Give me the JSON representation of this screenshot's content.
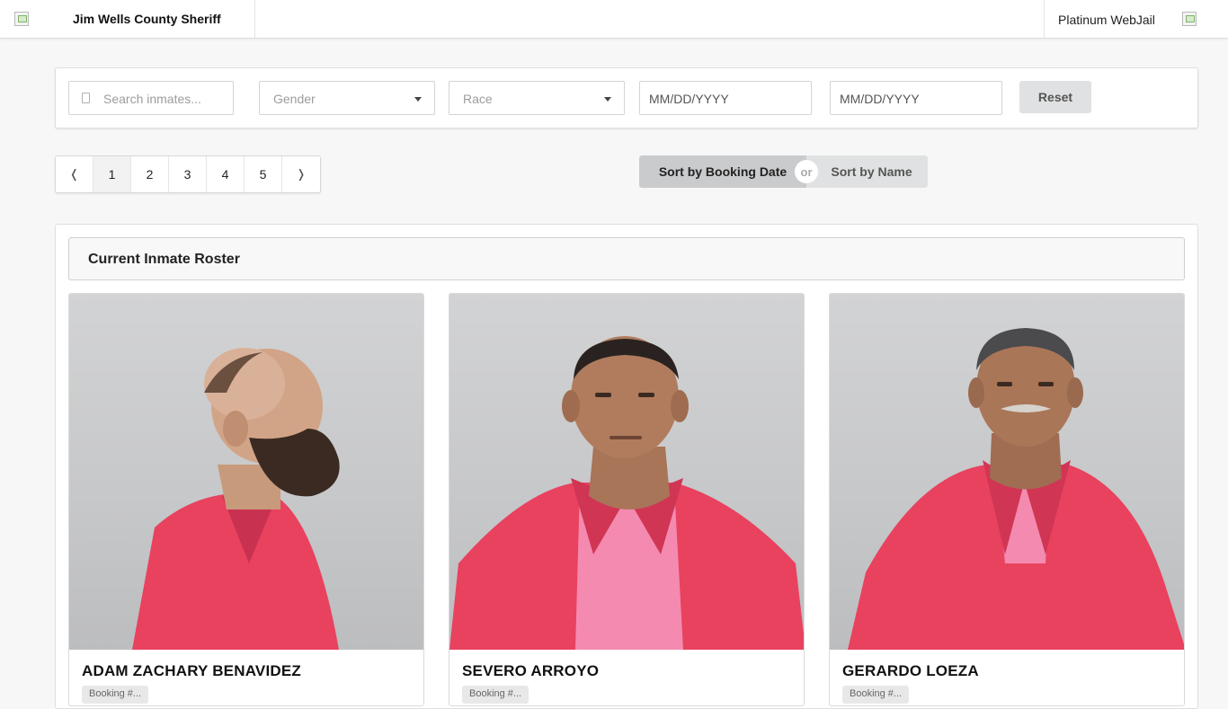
{
  "header": {
    "agency_name": "Jim Wells County Sheriff",
    "product_name": "Platinum WebJail",
    "logo_icon": "broken-image-icon",
    "user_icon": "broken-image-icon"
  },
  "filters": {
    "search_placeholder": "Search inmates...",
    "search_icon": "search-icon",
    "gender_placeholder": "Gender",
    "race_placeholder": "Race",
    "date_from_placeholder": "MM/DD/YYYY",
    "date_to_placeholder": "MM/DD/YYYY",
    "reset_label": "Reset"
  },
  "pagination": {
    "prev_label": "❬",
    "next_label": "❭",
    "pages": [
      "1",
      "2",
      "3",
      "4",
      "5"
    ],
    "active_page": "1"
  },
  "sort": {
    "by_booking_label": "Sort by Booking Date",
    "or_label": "or",
    "by_name_label": "Sort by Name",
    "active": "booking_date"
  },
  "roster": {
    "title": "Current Inmate Roster",
    "inmates": [
      {
        "name": "ADAM ZACHARY BENAVIDEZ",
        "booking_label": "Booking #..."
      },
      {
        "name": "SEVERO ARROYO",
        "booking_label": "Booking #..."
      },
      {
        "name": "GERARDO LOEZA",
        "booking_label": "Booking #..."
      }
    ]
  },
  "colors": {
    "uniform": "#e8425f",
    "background": "#f7f7f7",
    "button_gray": "#e0e1e2",
    "button_active": "#cacbcd"
  }
}
